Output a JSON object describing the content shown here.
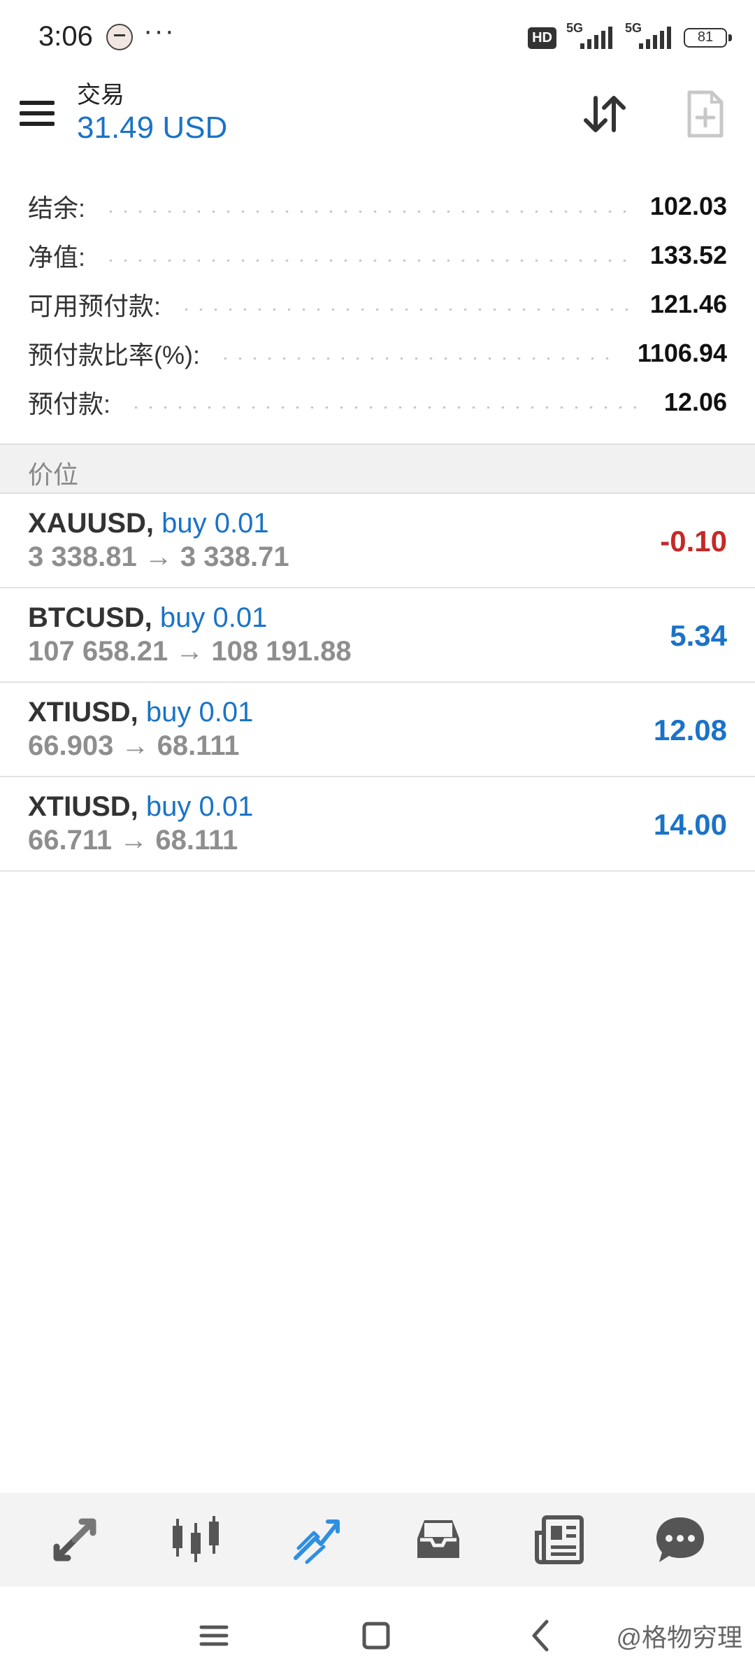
{
  "status": {
    "time": "3:06",
    "more": "···",
    "hd": "HD",
    "signal1": "5G",
    "signal2": "5G",
    "battery": "81"
  },
  "header": {
    "title": "交易",
    "balance": "31.49 USD"
  },
  "summary": [
    {
      "label": "结余:",
      "value": "102.03"
    },
    {
      "label": "净值:",
      "value": "133.52"
    },
    {
      "label": "可用预付款:",
      "value": "121.46"
    },
    {
      "label": "预付款比率(%):",
      "value": "1106.94"
    },
    {
      "label": "预付款:",
      "value": "12.06"
    }
  ],
  "section": {
    "title": "价位"
  },
  "positions": [
    {
      "symbol": "XAUUSD,",
      "side": "buy 0.01",
      "prices": "3 338.81 → 3 338.71",
      "profit": "-0.10",
      "color": "#c62828"
    },
    {
      "symbol": "BTCUSD,",
      "side": "buy 0.01",
      "prices": "107 658.21 → 108 191.88",
      "profit": "5.34",
      "color": "#1a73c7"
    },
    {
      "symbol": "XTIUSD,",
      "side": "buy 0.01",
      "prices": "66.903 → 68.111",
      "profit": "12.08",
      "color": "#1a73c7"
    },
    {
      "symbol": "XTIUSD,",
      "side": "buy 0.01",
      "prices": "66.711 → 68.111",
      "profit": "14.00",
      "color": "#1a73c7"
    }
  ],
  "bottom_nav": [
    {
      "icon": "quotes-icon"
    },
    {
      "icon": "chart-icon"
    },
    {
      "icon": "trade-icon",
      "active": true
    },
    {
      "icon": "history-icon"
    },
    {
      "icon": "news-icon"
    },
    {
      "icon": "chat-icon"
    }
  ],
  "colors": {
    "accent": "#1a73c7",
    "loss": "#c62828"
  },
  "watermark": "@格物穷理"
}
